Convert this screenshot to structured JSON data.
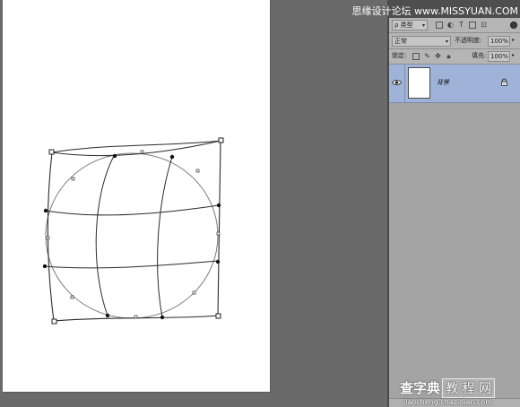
{
  "watermark_top": {
    "left": "思缘设计论坛",
    "sep": " ",
    "right": "www.MISSYUAN.COM"
  },
  "layers_panel": {
    "filter_kind": "ρ 类型",
    "blend_mode": "正常",
    "opacity_label": "不透明度:",
    "opacity_value": "100%",
    "lock_label": "锁定:",
    "fill_label": "填充:",
    "fill_value": "100%",
    "layers": [
      {
        "name": "背景",
        "visible": true,
        "locked": true,
        "selected": true
      }
    ]
  },
  "watermark_bottom": {
    "brand_a": "查字典",
    "brand_b": "教 程 网",
    "url": "jiaocheng.chazidian.com"
  },
  "colors": {
    "canvas_bg": "#6a6a6a",
    "panel_bg": "#a9a9a9",
    "layer_selected": "#9fb3d9",
    "warp_line": "#2b2b2b",
    "sphere_line": "#7a7a7a"
  }
}
